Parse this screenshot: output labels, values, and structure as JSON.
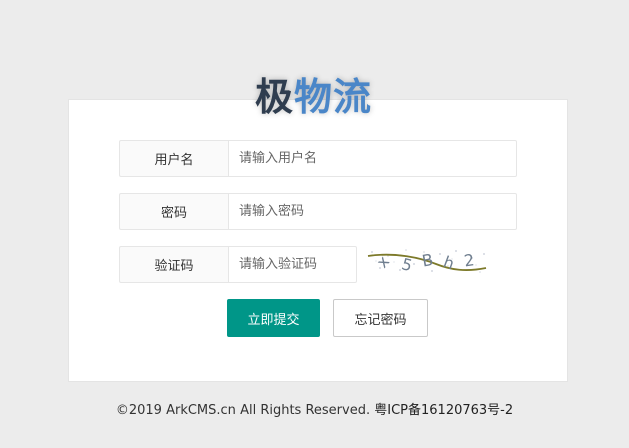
{
  "logo": {
    "part1": "极",
    "part2": "物流"
  },
  "form": {
    "username": {
      "label": "用户名",
      "placeholder": "请输入用户名",
      "value": ""
    },
    "password": {
      "label": "密码",
      "placeholder": "请输入密码",
      "value": ""
    },
    "captcha": {
      "label": "验证码",
      "placeholder": "请输入验证码",
      "value": "",
      "image_text": "x 5 B h 2"
    },
    "submit_label": "立即提交",
    "forgot_label": "忘记密码"
  },
  "footer": {
    "copyright": "©2019",
    "site": "ArkCMS.cn",
    "rights": "All Rights Reserved.",
    "icp": "粤ICP备16120763号-2"
  },
  "colors": {
    "primary": "#009688",
    "logo_dark": "#2f3d4f",
    "logo_blue": "#4a86c8",
    "background": "#ececec"
  }
}
